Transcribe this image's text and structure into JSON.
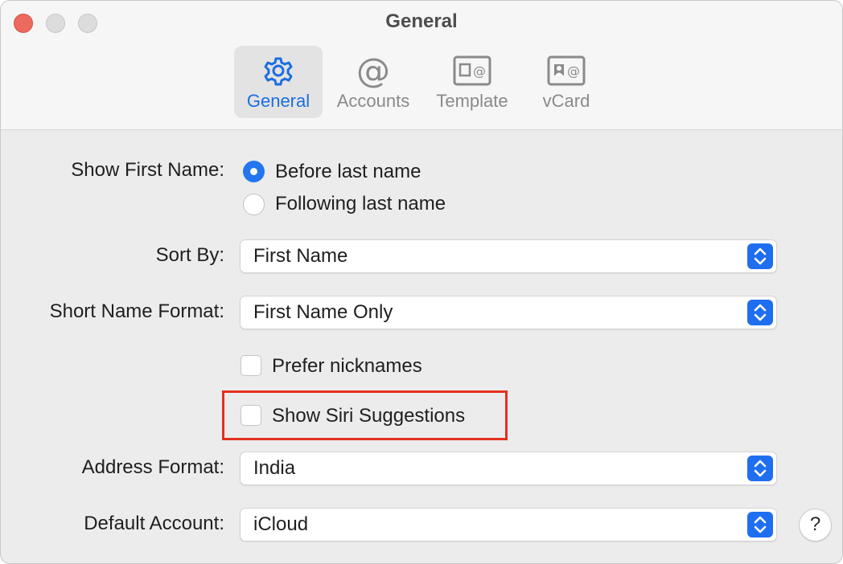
{
  "window": {
    "title": "General"
  },
  "toolbar": {
    "tabs": [
      {
        "label": "General",
        "icon": "gear-icon",
        "selected": true
      },
      {
        "label": "Accounts",
        "icon": "at-sign-icon",
        "selected": false
      },
      {
        "label": "Template",
        "icon": "template-card-icon",
        "selected": false
      },
      {
        "label": "vCard",
        "icon": "vcard-icon",
        "selected": false
      }
    ]
  },
  "form": {
    "show_first_name": {
      "label": "Show First Name:",
      "options": [
        "Before last name",
        "Following last name"
      ],
      "selected": "Before last name"
    },
    "sort_by": {
      "label": "Sort By:",
      "value": "First Name"
    },
    "short_name_format": {
      "label": "Short Name Format:",
      "value": "First Name Only"
    },
    "prefer_nicknames": {
      "label": "Prefer nicknames",
      "checked": false
    },
    "show_siri_suggestions": {
      "label": "Show Siri Suggestions",
      "checked": false
    },
    "address_format": {
      "label": "Address Format:",
      "value": "India"
    },
    "default_account": {
      "label": "Default Account:",
      "value": "iCloud"
    },
    "help": {
      "label": "?"
    }
  },
  "colors": {
    "accent": "#1f6ef0",
    "highlight": "#e4301f",
    "close_button": "#ed6a5e"
  }
}
